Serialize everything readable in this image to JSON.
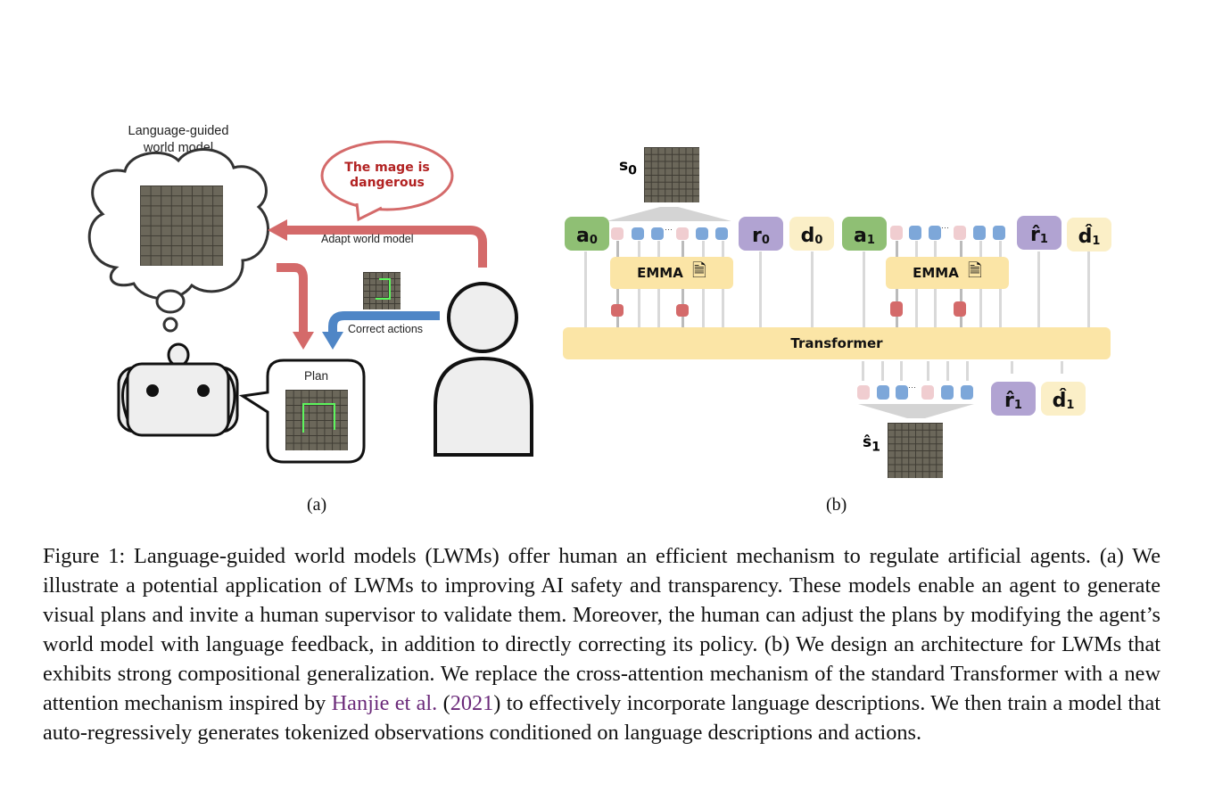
{
  "panel_a": {
    "thought_title": "Language-guided\nworld model",
    "speech_bubble": "The mage is dangerous",
    "adapt_label": "Adapt world model",
    "correct_label": "Correct actions",
    "plan_label": "Plan",
    "sublabel": "(a)"
  },
  "panel_b": {
    "s0": "s",
    "s0_sub": "0",
    "a0": "a",
    "a0_sub": "0",
    "r0": "r",
    "r0_sub": "0",
    "d0": "d",
    "d0_sub": "0",
    "a1": "a",
    "a1_sub": "1",
    "r1_hat": "r̂",
    "r1_sub": "1",
    "d1_hat": "d̂",
    "d1_sub": "1",
    "emma": "EMMA",
    "transformer": "Transformer",
    "s1_hat": "ŝ",
    "s1_sub": "1",
    "ellipsis": "···",
    "sublabel": "(b)"
  },
  "caption": {
    "part1": "Figure 1: Language-guided world models (LWMs) offer human an efficient mechanism to regulate artificial agents. (a) We illustrate a potential application of LWMs to improving AI safety and transparency. These models enable an agent to generate visual plans and invite a human supervisor to validate them. Moreover, the human can adjust the plans by modifying the agent’s world model with language feedback, in addition to directly correcting its policy. (b) We design an architecture for LWMs that exhibits strong compositional generalization. We replace the cross-attention mechanism of the standard Transformer with a new attention mechanism inspired by ",
    "cite_author": "Hanjie et al.",
    "cite_open": " (",
    "cite_year": "2021",
    "cite_close": ")",
    "part2": " to effectively incorporate language descriptions. We then train a model that auto-regressively generates tokenized observations conditioned on language descriptions and actions."
  }
}
